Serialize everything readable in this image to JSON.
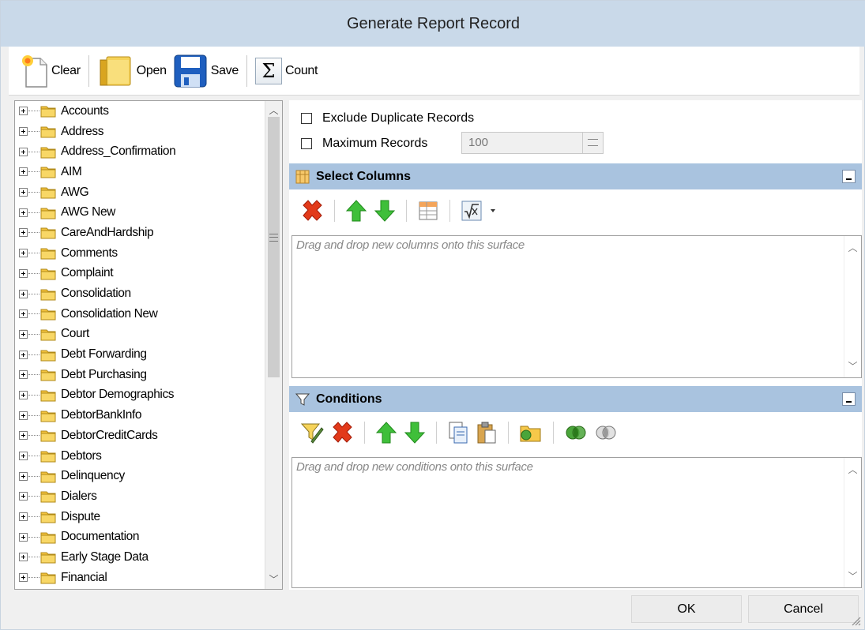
{
  "window": {
    "title": "Generate Report Record"
  },
  "toolbar": {
    "clear_label": "Clear",
    "open_label": "Open",
    "save_label": "Save",
    "count_label": "Count"
  },
  "tree": {
    "items": [
      "Accounts",
      "Address",
      "Address_Confirmation",
      "AIM",
      "AWG",
      "AWG New",
      "CareAndHardship",
      "Comments",
      "Complaint",
      "Consolidation",
      "Consolidation New",
      "Court",
      "Debt Forwarding",
      "Debt Purchasing",
      "Debtor Demographics",
      "DebtorBankInfo",
      "DebtorCreditCards",
      "Debtors",
      "Delinquency",
      "Dialers",
      "Dispute",
      "Documentation",
      "Early Stage Data",
      "Financial"
    ]
  },
  "options": {
    "exclude_duplicates_label": "Exclude Duplicate Records",
    "exclude_duplicates_checked": false,
    "max_records_label": "Maximum Records",
    "max_records_checked": false,
    "max_records_value": "100"
  },
  "select_columns": {
    "title": "Select Columns",
    "hint": "Drag and drop new columns onto this surface"
  },
  "conditions": {
    "title": "Conditions",
    "hint": "Drag and drop new conditions onto this surface"
  },
  "footer": {
    "ok_label": "OK",
    "cancel_label": "Cancel"
  }
}
